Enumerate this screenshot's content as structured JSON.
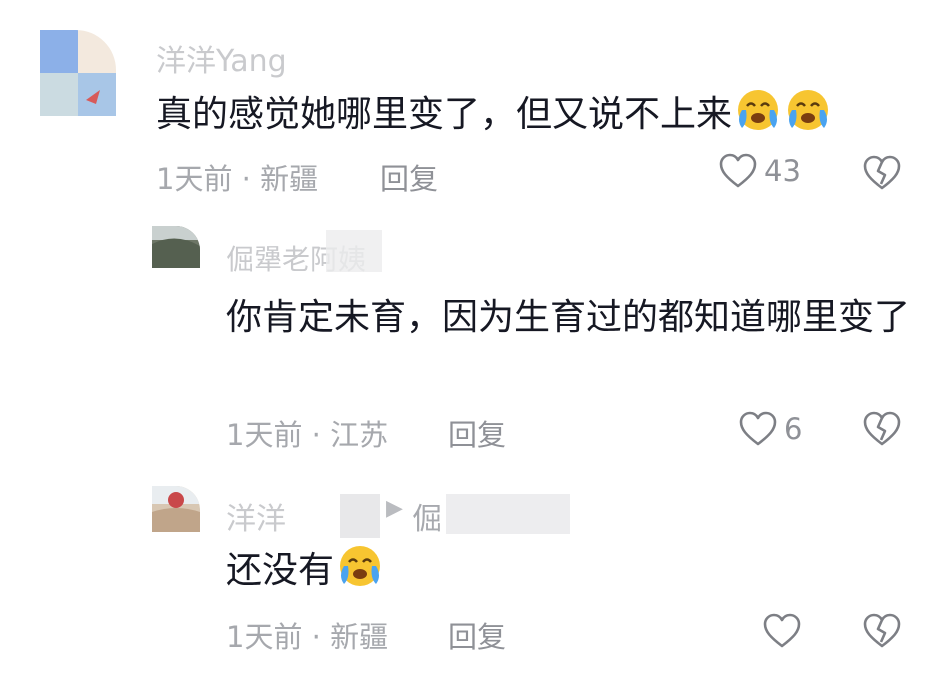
{
  "comments": [
    {
      "username": "洋洋Yang",
      "text": "真的感觉她哪里变了，但又说不上来",
      "emoji": [
        "crying-emoji",
        "crying-emoji"
      ],
      "time": "1天前",
      "location": "新疆",
      "reply_label": "回复",
      "likes": "43"
    },
    {
      "username": "倔犟老阿姨",
      "text": "你肯定未育，因为生育过的都知道哪里变了",
      "time": "1天前",
      "location": "江苏",
      "reply_label": "回复",
      "likes": "6"
    },
    {
      "username": "洋洋",
      "reply_to": "倔",
      "text": "还没有",
      "emoji": [
        "crying-emoji"
      ],
      "time": "1天前",
      "location": "新疆",
      "reply_label": "回复",
      "likes": ""
    }
  ],
  "separator": " · ",
  "icons": {
    "like": "heart-outline-icon",
    "dislike": "broken-heart-icon",
    "emoji": "crying-emoji"
  },
  "colors": {
    "text": "#161823",
    "meta": "#a6a8ad",
    "icon": "#7d7f85",
    "emoji_yellow": "#f7c531",
    "emoji_tear": "#4aa3f0"
  }
}
